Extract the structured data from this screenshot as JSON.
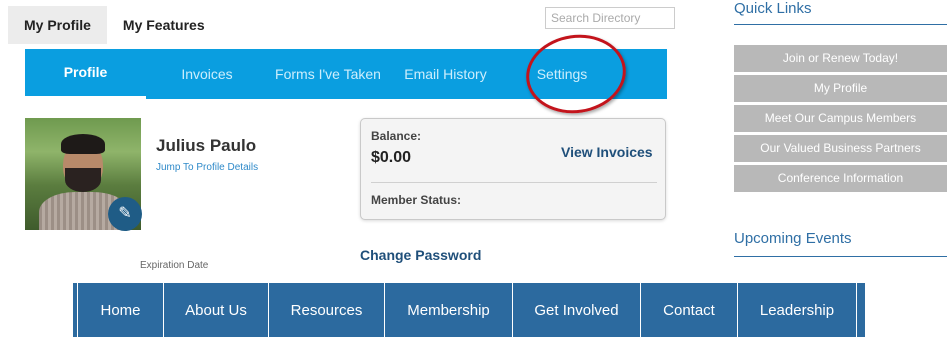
{
  "top_tabs": [
    {
      "label": "My Profile"
    },
    {
      "label": "My Features"
    }
  ],
  "search": {
    "placeholder": "Search Directory",
    "value": ""
  },
  "subnav": [
    {
      "label": "Profile"
    },
    {
      "label": "Invoices"
    },
    {
      "label": "Forms I've Taken"
    },
    {
      "label": "Email History"
    },
    {
      "label": "Settings"
    }
  ],
  "profile": {
    "name": "Julius Paulo",
    "details_link": "Jump To Profile Details",
    "partial_text": "Expiration Date",
    "edit_icon": "pencil-icon"
  },
  "account": {
    "balance_label": "Balance:",
    "balance_value": "$0.00",
    "view_invoices": "View Invoices",
    "member_status_label": "Member Status:",
    "change_password": "Change Password"
  },
  "sidebar": {
    "quick_links_title": "Quick Links",
    "quick_links": [
      {
        "label": "Join or Renew Today!"
      },
      {
        "label": "My Profile"
      },
      {
        "label": "Meet Our Campus Members"
      },
      {
        "label": "Our Valued Business Partners"
      },
      {
        "label": "Conference Information"
      }
    ],
    "upcoming_events_title": "Upcoming Events"
  },
  "main_nav": [
    {
      "label": "Home"
    },
    {
      "label": "About Us"
    },
    {
      "label": "Resources"
    },
    {
      "label": "Membership"
    },
    {
      "label": "Get Involved"
    },
    {
      "label": "Contact"
    },
    {
      "label": "Leadership"
    }
  ],
  "colors": {
    "subnav_bg": "#0a9ee0",
    "main_nav_bg": "#2c6a9f",
    "quick_link_bg": "#b8b8b8",
    "highlight": "#c3141c",
    "link": "#1f4f7a"
  }
}
